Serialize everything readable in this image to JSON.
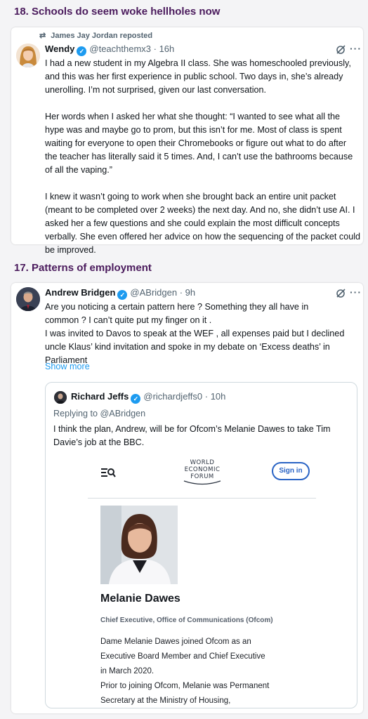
{
  "sections": [
    {
      "title": "18. Schools do seem woke hellholes now"
    },
    {
      "title": "17. Patterns of employment"
    }
  ],
  "post1": {
    "repost_label": "James Jay Jordan reposted",
    "name": "Wendy",
    "handle_time": "@teachthemx3 · 16h",
    "paragraphs": [
      "I had a new student in my Algebra II class. She was homeschooled previously, and this was her first experience in public school. Two days in, she’s already unerolling. I’m not surprised, given our last conversation.",
      "Her words when I asked her what she thought: “I wanted to see what all the hype was and maybe go to prom, but this isn’t for me. Most of class is spent waiting for everyone to open their Chromebooks or figure out what to do after the teacher has literally said it 5 times. And, I can’t use the bathrooms because of all the vaping.”",
      "I knew it wasn’t going to work when she brought back an entire unit packet (meant to be completed over 2 weeks) the next day. And no, she didn’t use AI. I asked her a few questions and she could explain the most difficult concepts verbally. She even offered her advice on how the sequencing of the packet could be improved."
    ]
  },
  "post2": {
    "name": "Andrew Bridgen",
    "handle_time": "@ABridgen · 9h",
    "lines": [
      "Are you noticing a certain pattern here ? Something they all have in",
      "common ? I can’t quite put my finger on it .",
      "I was invited to Davos to speak at the WEF , all expenses paid but I declined",
      "uncle Klaus’ kind invitation and spoke in my debate on ‘Excess deaths’ in",
      "Parliament"
    ],
    "show_more": "Show more",
    "quote": {
      "name": "Richard Jeffs",
      "handle_time": "@richardjeffs0 · 10h",
      "replying_to": "Replying to @ABridgen",
      "text": "I think the plan, Andrew, will be for Ofcom’s Melanie Dawes to take Tim Davie’s job at the BBC.",
      "wef": {
        "logo_lines": [
          "WORLD",
          "ECONOMIC",
          "FORUM"
        ],
        "sign_in": "Sign in",
        "person_name": "Melanie Dawes",
        "person_role": "Chief Executive, Office of Communications (Ofcom)",
        "bio_lines": [
          "Dame Melanie Dawes joined Ofcom as an",
          "Executive Board Member and Chief Executive",
          "in March 2020.",
          "Prior to joining Ofcom, Melanie was Permanent",
          "Secretary at the Ministry of Housing,"
        ]
      }
    }
  },
  "colors": {
    "section_title": "#4a1a5c",
    "verified": "#1d9bf0",
    "link": "#1d9bf0",
    "wef_blue": "#2a64c5"
  },
  "icons": [
    "repost-icon",
    "verified-icon",
    "grok-icon",
    "more-icon",
    "menu-search-icon",
    "wef-logo-arc"
  ]
}
